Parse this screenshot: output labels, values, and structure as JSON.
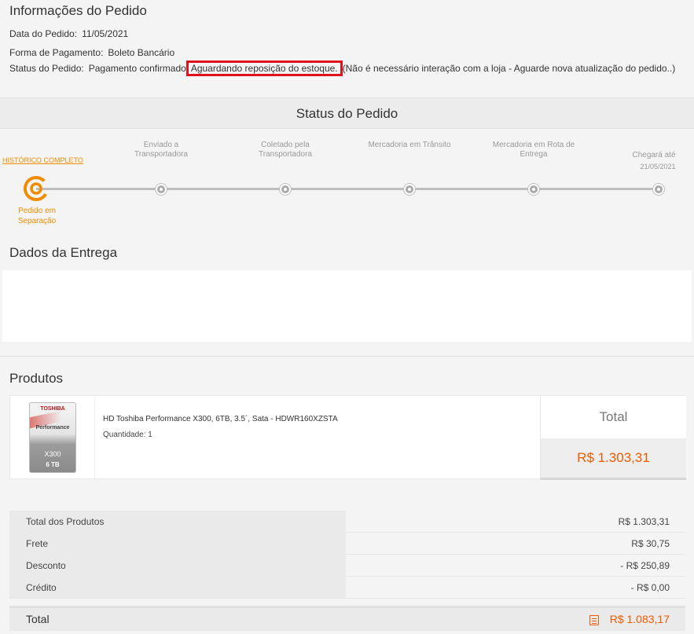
{
  "order_info": {
    "title": "Informações do Pedido",
    "date_label": "Data do Pedido:",
    "date_value": "11/05/2021",
    "payment_label": "Forma de Pagamento:",
    "payment_value": "Boleto Bancário",
    "status_label": "Status do Pedido:",
    "status_prefix": "Pagamento confirmado",
    "status_highlight": "Aguardando reposição do estoque.",
    "status_suffix": "(Não é necessário interação com a loja - Aguarde nova atualização do pedido..)"
  },
  "status": {
    "title": "Status do Pedido",
    "history_link": "HISTÓRICO COMPLETO",
    "current_step": "Pedido em Separação",
    "steps": [
      {
        "label": "Enviado a Transportadora"
      },
      {
        "label": "Coletado pela Transportadora"
      },
      {
        "label": "Mercadoria em Trânsito"
      },
      {
        "label": "Mercadoria em Rota de Entrega"
      },
      {
        "label": "Chegará até",
        "date": "21/05/2021"
      }
    ]
  },
  "delivery": {
    "title": "Dados da Entrega"
  },
  "products": {
    "title": "Produtos",
    "items": [
      {
        "name": "HD Toshiba Performance X300, 6TB, 3.5´, Sata - HDWR160XZSTA",
        "quantity": "Quantidade: 1",
        "total_label": "Total",
        "total_value": "R$ 1.303,31",
        "image": {
          "brand": "TOSHIBA",
          "line": "Performance",
          "model": "X300",
          "capacity": "6 TB"
        }
      }
    ]
  },
  "summary": {
    "rows": [
      {
        "label": "Total dos Produtos",
        "value": "R$ 1.303,31"
      },
      {
        "label": "Frete",
        "value": "R$ 30,75"
      },
      {
        "label": "Desconto",
        "value": "- R$ 250,89"
      },
      {
        "label": "Crédito",
        "value": "- R$ 0,00"
      }
    ],
    "total_label": "Total",
    "total_value": "R$ 1.083,17"
  },
  "colors": {
    "accent": "#f08c00",
    "price": "#f05a00",
    "highlight_border": "#e0121b"
  }
}
